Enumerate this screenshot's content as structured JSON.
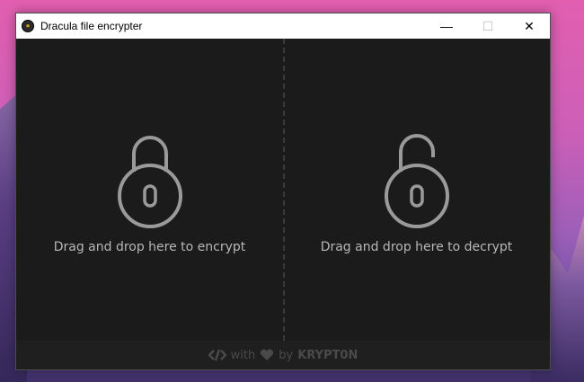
{
  "window": {
    "title": "Dracula file encrypter",
    "icon": "dracula-app-icon",
    "controls": [
      "minimize",
      "maximize",
      "close"
    ]
  },
  "caption": {
    "minimize_glyph": "—",
    "maximize_glyph": "☐",
    "close_glyph": "✕"
  },
  "panes": {
    "encrypt": {
      "label": "Drag and drop here to encrypt",
      "icon": "lock-closed-icon"
    },
    "decrypt": {
      "label": "Drag and drop here to decrypt",
      "icon": "lock-open-icon"
    }
  },
  "footer": {
    "code_icon": "code-icon",
    "with_text": "with",
    "heart_icon": "heart-icon",
    "by_text": "by",
    "brand": "KRYPT0N"
  },
  "colors": {
    "window_bg": "#1b1b1b",
    "lock_stroke": "#9a9a9a",
    "label_text": "#b7b7b7",
    "footer_text": "#4a4a4a"
  }
}
